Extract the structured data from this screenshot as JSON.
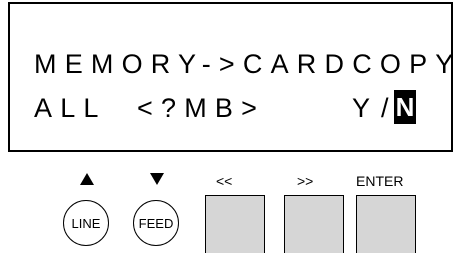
{
  "display": {
    "line1": "MEMORY->CARDCOPY",
    "line2_left": "ALL  <?MB>",
    "line2_yes": "Y",
    "line2_slash": "/",
    "line2_cursor": "N"
  },
  "keypad": {
    "line_label": "LINE",
    "feed_label": "FEED",
    "prev_label": "<<",
    "next_label": ">>",
    "enter_label": "ENTER",
    "line_arrow_icon": "up-triangle-icon",
    "feed_arrow_icon": "down-triangle-icon"
  },
  "colors": {
    "background": "#ffffff",
    "text": "#000000",
    "key_face": "#d6d6d6",
    "cursor_bg": "#000000",
    "cursor_fg": "#ffffff"
  }
}
